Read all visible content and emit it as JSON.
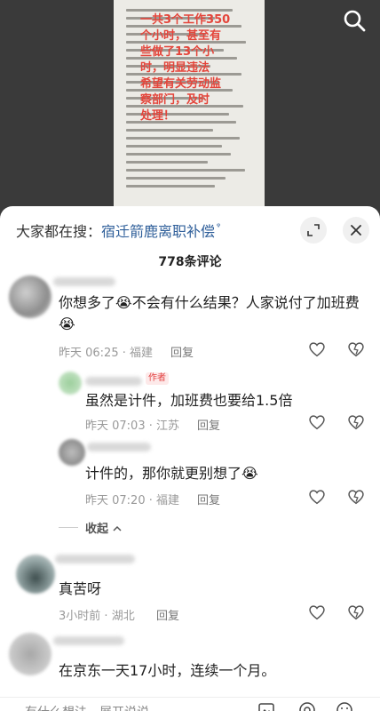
{
  "search_bar": {
    "prefix": "大家都在搜：",
    "query": "宿迁箭鹿离职补偿",
    "glyph": "ᵠ"
  },
  "comments_header": {
    "count_text": "778条评论"
  },
  "comments": [
    {
      "text": "你想多了😭不会有什么结果？人家说付了加班费",
      "text_line2": "😭",
      "time": "昨天 06:25",
      "location": "福建",
      "reply_label": "回复"
    },
    {
      "text": "虽然是计件，加班费也要给1.5倍",
      "time": "昨天 07:03",
      "location": "江苏",
      "reply_label": "回复",
      "author_tag": "作者"
    },
    {
      "text": "计件的，那你就更别想了😭",
      "time": "昨天 07:20",
      "location": "福建",
      "reply_label": "回复"
    },
    {
      "text": "真苦呀",
      "time": "3小时前",
      "location": "湖北",
      "reply_label": "回复"
    },
    {
      "text": "在京东一天17小时，连续一个月。"
    }
  ],
  "collapse_label": "收起",
  "input_bar": {
    "placeholder": "有什么想法，展开说说"
  },
  "colors": {
    "link": "#2f5f9a",
    "author_tag": "#e24141",
    "overlay_red": "#e4453b"
  },
  "icons": [
    "search-icon",
    "expand-icon",
    "close-icon",
    "heart-icon",
    "dislike-heart-icon",
    "emoji-icon",
    "at-icon"
  ]
}
